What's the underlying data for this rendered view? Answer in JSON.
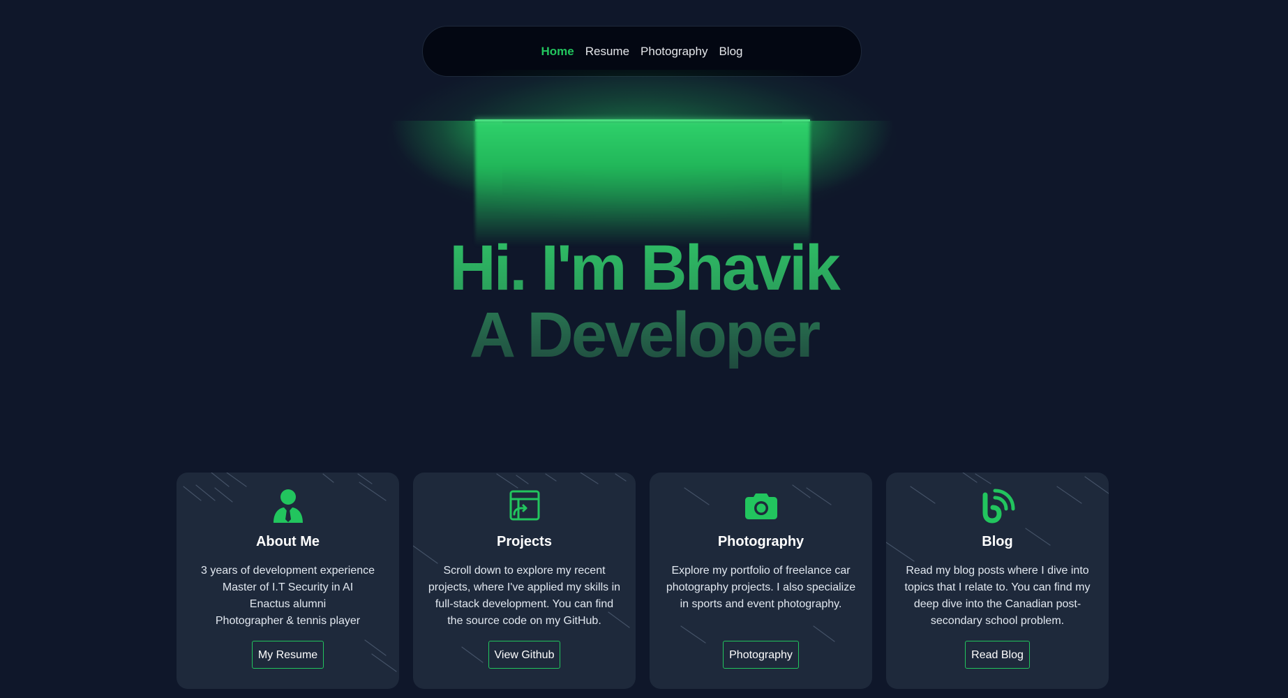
{
  "nav": {
    "items": [
      {
        "label": "Home",
        "active": true
      },
      {
        "label": "Resume",
        "active": false
      },
      {
        "label": "Photography",
        "active": false
      },
      {
        "label": "Blog",
        "active": false
      }
    ]
  },
  "hero": {
    "line1": "Hi. I'm Bhavik",
    "line2": "A Developer"
  },
  "cards": [
    {
      "icon": "user-tie-icon",
      "title": "About Me",
      "lines": [
        "3 years of development experience",
        "Master of I.T Security in AI",
        "Enactus alumni",
        "Photographer & tennis player"
      ],
      "button": "My Resume"
    },
    {
      "icon": "project-window-icon",
      "title": "Projects",
      "text": "Scroll down to explore my recent projects, where I've applied my skills in full-stack development. You can find the source code on my GitHub.",
      "button": "View Github"
    },
    {
      "icon": "camera-icon",
      "title": "Photography",
      "text": "Explore my portfolio of freelance car photography projects. I also specialize in sports and event photography.",
      "button": "Photography"
    },
    {
      "icon": "blog-icon",
      "title": "Blog",
      "text": "Read my blog posts where I dive into topics that I relate to. You can find my deep dive into the Canadian post-secondary school problem.",
      "button": "Read Blog"
    }
  ],
  "colors": {
    "background": "#0f172a",
    "accent": "#22c55e",
    "card": "#1e293b",
    "nav": "#030712"
  }
}
